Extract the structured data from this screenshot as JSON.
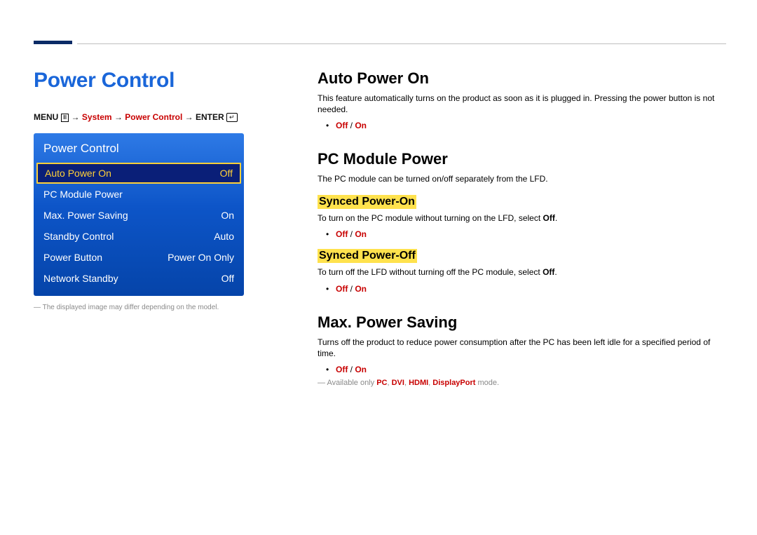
{
  "left": {
    "title": "Power Control",
    "breadcrumb": {
      "menu": "MENU",
      "arrow": "→",
      "system": "System",
      "power_control": "Power Control",
      "enter": "ENTER"
    },
    "osd": {
      "title": "Power Control",
      "rows": [
        {
          "label": "Auto Power On",
          "value": "Off",
          "selected": true
        },
        {
          "label": "PC Module Power",
          "value": "",
          "selected": false
        },
        {
          "label": "Max. Power Saving",
          "value": "On",
          "selected": false
        },
        {
          "label": "Standby Control",
          "value": "Auto",
          "selected": false
        },
        {
          "label": "Power Button",
          "value": "Power On Only",
          "selected": false
        },
        {
          "label": "Network Standby",
          "value": "Off",
          "selected": false
        }
      ]
    },
    "footnote": "The displayed image may differ depending on the model."
  },
  "right": {
    "auto_power_on": {
      "title": "Auto Power On",
      "desc": "This feature automatically turns on the product as soon as it is plugged in. Pressing the power button is not needed.",
      "off": "Off",
      "sep": " / ",
      "on": "On"
    },
    "pc_module": {
      "title": "PC Module Power",
      "desc": "The PC module can be turned on/off separately from the LFD.",
      "synced_on": {
        "title": "Synced Power-On",
        "desc_pre": "To turn on the PC module without turning on the LFD, select ",
        "desc_bold": "Off",
        "desc_post": ".",
        "off": "Off",
        "sep": " / ",
        "on": "On"
      },
      "synced_off": {
        "title": "Synced Power-Off",
        "desc_pre": "To turn off the LFD without turning off the PC module, select ",
        "desc_bold": "Off",
        "desc_post": ".",
        "off": "Off",
        "sep": " / ",
        "on": "On"
      }
    },
    "max_saving": {
      "title": "Max. Power Saving",
      "desc": "Turns off the product to reduce power consumption after the PC has been left idle for a specified period of time.",
      "off": "Off",
      "sep": " / ",
      "on": "On",
      "note_pre": "Available only ",
      "note_modes": [
        "PC",
        "DVI",
        "HDMI",
        "DisplayPort"
      ],
      "note_sep": ", ",
      "note_post": " mode."
    }
  }
}
